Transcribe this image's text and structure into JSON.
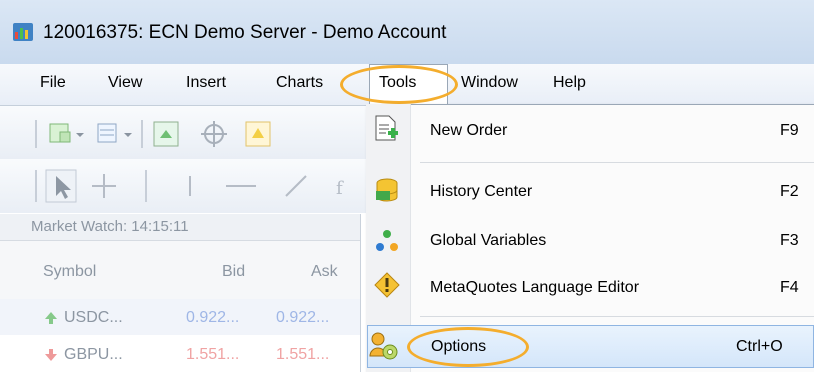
{
  "window": {
    "title": "120016375: ECN Demo Server - Demo Account"
  },
  "menubar": {
    "items": [
      {
        "label": "File"
      },
      {
        "label": "View"
      },
      {
        "label": "Insert"
      },
      {
        "label": "Charts"
      },
      {
        "label": "Tools"
      },
      {
        "label": "Window"
      },
      {
        "label": "Help"
      }
    ]
  },
  "market_watch": {
    "title": "Market Watch: 14:15:11",
    "columns": [
      "Symbol",
      "Bid",
      "Ask"
    ],
    "rows": [
      {
        "symbol": "USDC...",
        "bid": "0.922...",
        "ask": "0.922...",
        "direction": "up",
        "color": "#9fb6e6"
      },
      {
        "symbol": "GBPU...",
        "bid": "1.551...",
        "ask": "1.551...",
        "direction": "down",
        "color": "#f0a3a3"
      }
    ]
  },
  "tools_menu": {
    "items": [
      {
        "label": "New Order",
        "shortcut": "F9",
        "icon": "new-order-icon"
      },
      {
        "label": "History Center",
        "shortcut": "F2",
        "icon": "history-center-icon"
      },
      {
        "label": "Global Variables",
        "shortcut": "F3",
        "icon": "global-variables-icon"
      },
      {
        "label": "MetaQuotes Language Editor",
        "shortcut": "F4",
        "icon": "metaeditor-icon"
      },
      {
        "label": "Options",
        "shortcut": "Ctrl+O",
        "icon": "options-icon",
        "highlighted": true
      }
    ]
  },
  "colors": {
    "highlight_oval": "#f4ad2d",
    "menu_highlight": "#d4e6fa"
  }
}
